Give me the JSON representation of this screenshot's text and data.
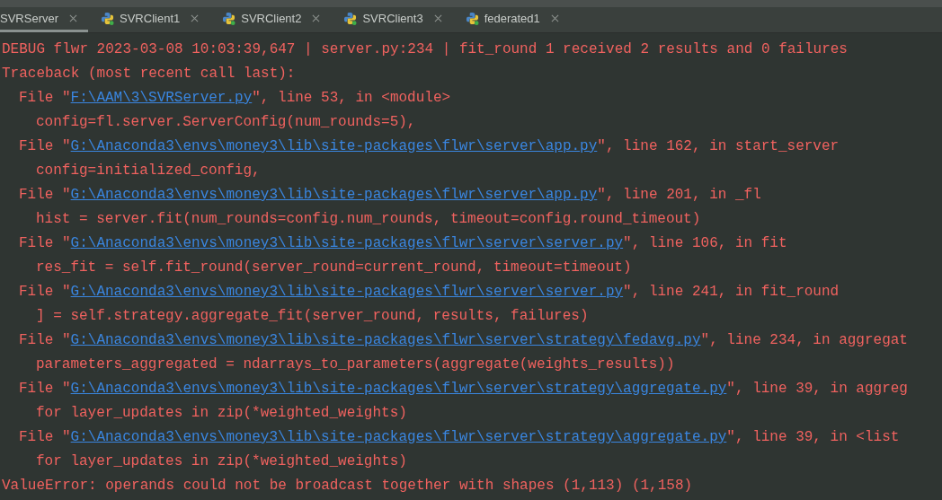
{
  "tabs": [
    {
      "label": "SVRServer",
      "kind": "plain",
      "selected": true
    },
    {
      "label": "SVRClient1",
      "kind": "python",
      "selected": false
    },
    {
      "label": "SVRClient2",
      "kind": "python",
      "selected": false
    },
    {
      "label": "SVRClient3",
      "kind": "python",
      "selected": false
    },
    {
      "label": "federated1",
      "kind": "python",
      "selected": false
    }
  ],
  "console": [
    {
      "kind": "text",
      "text": "DEBUG flwr 2023-03-08 10:03:39,647 | server.py:234 | fit_round 1 received 2 results and 0 failures"
    },
    {
      "kind": "text",
      "text": "Traceback (most recent call last):"
    },
    {
      "kind": "file",
      "prefix": "File \"",
      "path": "F:\\AAM\\3\\SVRServer.py",
      "rest": "\", line 53, in <module>"
    },
    {
      "kind": "code",
      "text": "config=fl.server.ServerConfig(num_rounds=5),"
    },
    {
      "kind": "file",
      "path": "G:\\Anaconda3\\envs\\money3\\lib\\site-packages\\flwr\\server\\app.py",
      "prefix": "File \"",
      "rest": "\", line 162, in start_server"
    },
    {
      "kind": "code",
      "text": "config=initialized_config,"
    },
    {
      "kind": "file",
      "path": "G:\\Anaconda3\\envs\\money3\\lib\\site-packages\\flwr\\server\\app.py",
      "prefix": "File \"",
      "rest": "\", line 201, in _fl"
    },
    {
      "kind": "code",
      "text": "hist = server.fit(num_rounds=config.num_rounds, timeout=config.round_timeout)"
    },
    {
      "kind": "file",
      "path": "G:\\Anaconda3\\envs\\money3\\lib\\site-packages\\flwr\\server\\server.py",
      "prefix": "File \"",
      "rest": "\", line 106, in fit"
    },
    {
      "kind": "code",
      "text": "res_fit = self.fit_round(server_round=current_round, timeout=timeout)"
    },
    {
      "kind": "file",
      "path": "G:\\Anaconda3\\envs\\money3\\lib\\site-packages\\flwr\\server\\server.py",
      "prefix": "File \"",
      "rest": "\", line 241, in fit_round"
    },
    {
      "kind": "code",
      "text": "] = self.strategy.aggregate_fit(server_round, results, failures)"
    },
    {
      "kind": "file",
      "path": "G:\\Anaconda3\\envs\\money3\\lib\\site-packages\\flwr\\server\\strategy\\fedavg.py",
      "prefix": "File \"",
      "rest": "\", line 234, in aggregat"
    },
    {
      "kind": "code",
      "text": "parameters_aggregated = ndarrays_to_parameters(aggregate(weights_results))"
    },
    {
      "kind": "file",
      "path": "G:\\Anaconda3\\envs\\money3\\lib\\site-packages\\flwr\\server\\strategy\\aggregate.py",
      "prefix": "File \"",
      "rest": "\", line 39, in aggreg"
    },
    {
      "kind": "code",
      "text": "for layer_updates in zip(*weighted_weights)"
    },
    {
      "kind": "file",
      "path": "G:\\Anaconda3\\envs\\money3\\lib\\site-packages\\flwr\\server\\strategy\\aggregate.py",
      "prefix": "File \"",
      "rest": "\", line 39, in <list"
    },
    {
      "kind": "code",
      "text": "for layer_updates in zip(*weighted_weights)"
    },
    {
      "kind": "text",
      "text": "ValueError: operands could not be broadcast together with shapes (1,113) (1,158)"
    }
  ]
}
